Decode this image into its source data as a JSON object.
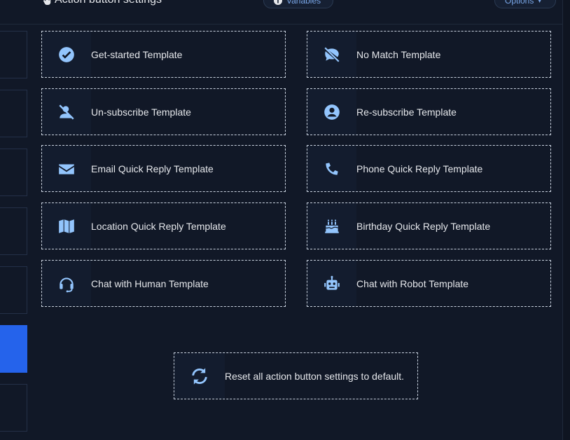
{
  "header": {
    "title": "Action button settings",
    "variables_label": "Variables",
    "options_label": "Options"
  },
  "cards": [
    {
      "label": "Get-started Template",
      "icon": "check-circle-icon"
    },
    {
      "label": "No Match Template",
      "icon": "comment-slash-icon"
    },
    {
      "label": "Un-subscribe Template",
      "icon": "user-slash-icon"
    },
    {
      "label": "Re-subscribe Template",
      "icon": "user-circle-icon"
    },
    {
      "label": "Email Quick Reply Template",
      "icon": "envelope-icon"
    },
    {
      "label": "Phone Quick Reply Template",
      "icon": "phone-icon"
    },
    {
      "label": "Location Quick Reply Template",
      "icon": "map-icon"
    },
    {
      "label": "Birthday Quick Reply Template",
      "icon": "birthday-cake-icon"
    },
    {
      "label": "Chat with Human Template",
      "icon": "headset-icon"
    },
    {
      "label": "Chat with Robot Template",
      "icon": "robot-icon"
    }
  ],
  "reset": {
    "label": "Reset all action button settings to default.",
    "icon": "sync-icon"
  },
  "colors": {
    "accent": "#2563eb",
    "icon": "#93c5fd",
    "background": "#111827"
  }
}
